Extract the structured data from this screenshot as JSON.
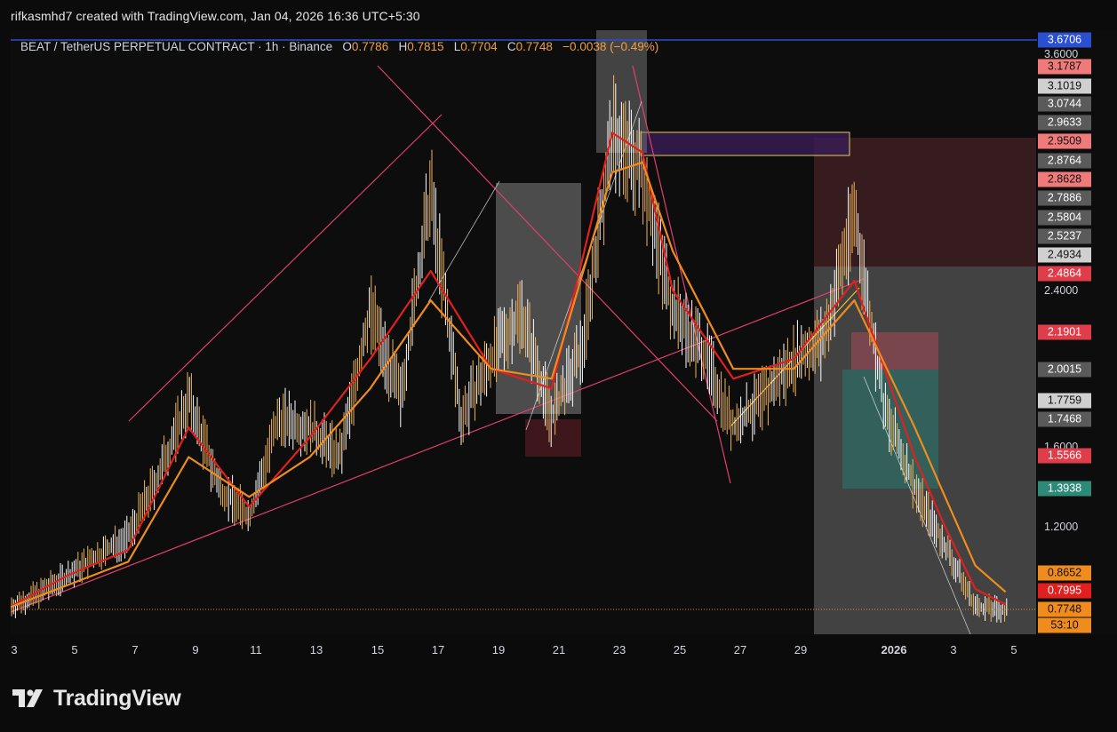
{
  "header": {
    "attribution": "rifkasmhd7 created with TradingView.com, Jan 04, 2026 16:36 UTC+5:30"
  },
  "legend": {
    "symbol": "BEAT / TetherUS PERPETUAL CONTRACT · 1h · Binance",
    "o_label": "O",
    "o_value": "0.7786",
    "h_label": "H",
    "h_value": "0.7815",
    "l_label": "L",
    "l_value": "0.7704",
    "c_label": "C",
    "c_value": "0.7748",
    "change": "−0.0038 (−0.49%)"
  },
  "logo": {
    "text": "TradingView"
  },
  "colors": {
    "candle": "#f0b45a",
    "ema_fast": "#e0201e",
    "ema_slow": "#f08c1e",
    "trendline": "#e0406a",
    "zone_red": "#5a2a2e",
    "zone_green": "#2e6e66",
    "zone_gray": "#707070",
    "zone_purple": "#3a1d55"
  },
  "chart_data": {
    "type": "line",
    "title": "BEAT / TetherUS PERPETUAL CONTRACT · 1h · Binance",
    "x_tick_labels": [
      "3",
      "5",
      "7",
      "9",
      "11",
      "13",
      "15",
      "17",
      "19",
      "21",
      "23",
      "25",
      "27",
      "29",
      "2026",
      "3",
      "5"
    ],
    "y_tick_labels": [
      "1.2000",
      "1.6000",
      "2.4000",
      "3.6000"
    ],
    "ylim": [
      0.65,
      3.7
    ],
    "grid": false,
    "series": [
      {
        "name": "",
        "color": "#f0b45a",
        "x": [
          "Dec 2",
          "Dec 3",
          "Dec 4",
          "Dec 5",
          "Dec 6",
          "Dec 7",
          "Dec 8",
          "Dec 9",
          "Dec 10",
          "Dec 11",
          "Dec 12",
          "Dec 13",
          "Dec 14",
          "Dec 15",
          "Dec 16",
          "Dec 17",
          "Dec 18",
          "Dec 19",
          "Dec 20",
          "Dec 21",
          "Dec 22",
          "Dec 23",
          "Dec 24",
          "Dec 25",
          "Dec 26",
          "Dec 27",
          "Dec 28",
          "Dec 29",
          "Dec 30",
          "Dec 31",
          "Jan 1",
          "Jan 2",
          "Jan 3",
          "Jan 4"
        ],
        "values": [
          0.78,
          0.85,
          0.95,
          1.05,
          1.15,
          1.45,
          1.85,
          1.4,
          1.25,
          1.75,
          1.7,
          1.55,
          2.3,
          1.85,
          2.9,
          1.75,
          2.05,
          2.3,
          1.75,
          2.1,
          3.2,
          3.0,
          2.3,
          2.1,
          1.7,
          1.85,
          2.05,
          2.15,
          2.8,
          1.78,
          1.4,
          1.1,
          0.79,
          0.77
        ]
      },
      {
        "name": "",
        "color": "#e0201e",
        "x": [
          "Dec 2",
          "Dec 4",
          "Dec 6",
          "Dec 8",
          "Dec 10",
          "Dec 12",
          "Dec 14",
          "Dec 16",
          "Dec 18",
          "Dec 20",
          "Dec 22",
          "Dec 23",
          "Dec 24",
          "Dec 26",
          "Dec 28",
          "Dec 30",
          "Jan 1",
          "Jan 2",
          "Jan 3",
          "Jan 4"
        ],
        "values": [
          0.78,
          0.95,
          1.08,
          1.7,
          1.3,
          1.65,
          2.05,
          2.5,
          2.0,
          1.9,
          3.2,
          3.1,
          2.4,
          1.95,
          2.05,
          2.45,
          1.55,
          1.2,
          0.88,
          0.8
        ]
      },
      {
        "name": "",
        "color": "#f08c1e",
        "x": [
          "Dec 2",
          "Dec 4",
          "Dec 6",
          "Dec 8",
          "Dec 10",
          "Dec 12",
          "Dec 14",
          "Dec 16",
          "Dec 18",
          "Dec 20",
          "Dec 22",
          "Dec 23",
          "Dec 24",
          "Dec 26",
          "Dec 28",
          "Dec 30",
          "Jan 1",
          "Jan 2",
          "Jan 3",
          "Jan 4"
        ],
        "values": [
          0.78,
          0.9,
          1.02,
          1.55,
          1.35,
          1.55,
          1.9,
          2.35,
          2.0,
          1.95,
          3.0,
          3.05,
          2.6,
          2.0,
          2.0,
          2.35,
          1.7,
          1.35,
          1.0,
          0.865
        ]
      }
    ],
    "price_badges": [
      {
        "value": "3.6706",
        "color": "#2a4fd0"
      },
      {
        "value": "3.1787",
        "color": "#f07a7a"
      },
      {
        "value": "3.1019",
        "color": "#d0d0d0"
      },
      {
        "value": "3.0744",
        "color": "#5a5a5a"
      },
      {
        "value": "2.9633",
        "color": "#5a5a5a"
      },
      {
        "value": "2.9509",
        "color": "#f07a7a"
      },
      {
        "value": "2.8764",
        "color": "#5a5a5a"
      },
      {
        "value": "2.8628",
        "color": "#f07a7a"
      },
      {
        "value": "2.7886",
        "color": "#5a5a5a"
      },
      {
        "value": "2.5804",
        "color": "#5a5a5a"
      },
      {
        "value": "2.5237",
        "color": "#5a5a5a"
      },
      {
        "value": "2.4934",
        "color": "#d0d0d0"
      },
      {
        "value": "2.4864",
        "color": "#e03d4a"
      },
      {
        "value": "2.1901",
        "color": "#e03d4a"
      },
      {
        "value": "2.0015",
        "color": "#5a5a5a"
      },
      {
        "value": "1.7759",
        "color": "#d0d0d0"
      },
      {
        "value": "1.7468",
        "color": "#5a5a5a"
      },
      {
        "value": "1.5566",
        "color": "#e03d4a"
      },
      {
        "value": "1.3938",
        "color": "#2e8a78"
      },
      {
        "value": "0.8652",
        "color": "#f08c1e"
      },
      {
        "value": "0.7995",
        "color": "#e0201e"
      },
      {
        "value": "0.7748",
        "color": "#f08c1e"
      }
    ],
    "countdown": "53:10"
  }
}
